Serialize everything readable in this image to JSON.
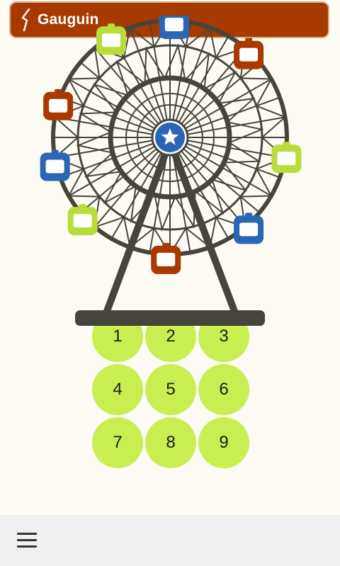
{
  "header": {
    "title": "Gauguin",
    "logo_icon": "gauguin-logo-icon"
  },
  "wheel": {
    "hub_icon": "star-icon",
    "frame_color": "#45453b",
    "hub_color": "#2a66b5",
    "gondola_colors": [
      "#2a66b5",
      "#a83a00",
      "#b8dc3a"
    ]
  },
  "keypad": {
    "keys": [
      "1",
      "2",
      "3",
      "4",
      "5",
      "6",
      "7",
      "8",
      "9"
    ],
    "key_color": "#c9ee52"
  },
  "bottom_bar": {
    "menu_icon": "hamburger-menu-icon"
  },
  "colors": {
    "accent": "#a83a00",
    "background": "#fdfbf3"
  }
}
